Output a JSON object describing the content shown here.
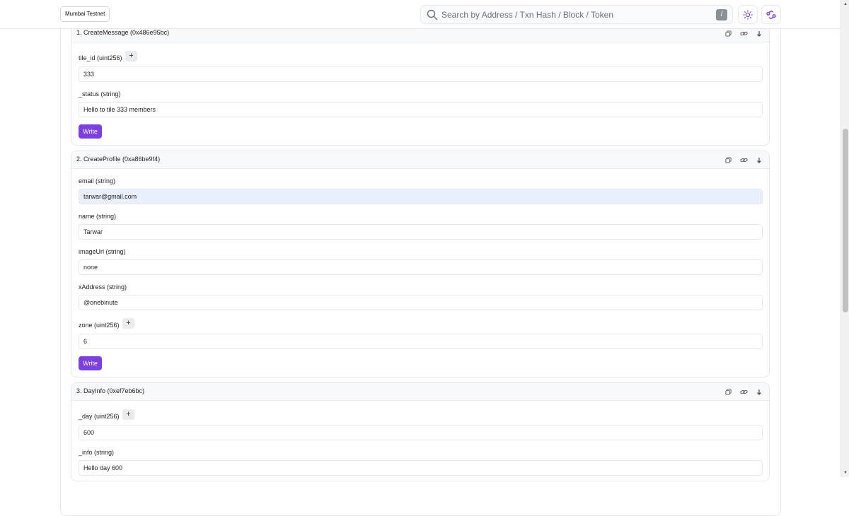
{
  "header": {
    "network_label": "Mumbai Testnet",
    "search_placeholder": "Search by Address / Txn Hash / Block / Token",
    "search_shortcut": "/"
  },
  "colors": {
    "accent": "#7b3fe4",
    "polygon": "#8247e5",
    "highlight_input": "#e8f0fe"
  },
  "sections": [
    {
      "title": "1. CreateMessage (0x486e95bc)",
      "fields": [
        {
          "label": "tile_id (uint256)",
          "value": "333",
          "has_plus": true
        },
        {
          "label": "_status (string)",
          "value": "Hello to tile 333 members",
          "has_plus": false
        }
      ],
      "write_label": "Write"
    },
    {
      "title": "2. CreateProfile (0xa86be9f4)",
      "fields": [
        {
          "label": "email (string)",
          "value": "tarwar@gmail.com",
          "has_plus": false
        },
        {
          "label": "name (string)",
          "value": "Tarwar",
          "has_plus": false
        },
        {
          "label": "imageUrl (string)",
          "value": "none",
          "has_plus": false
        },
        {
          "label": "xAddress (string)",
          "value": "@onebinute",
          "has_plus": false
        },
        {
          "label": "zone (uint256)",
          "value": "6",
          "has_plus": true
        }
      ],
      "write_label": "Write"
    },
    {
      "title": "3. DayInfo (0xef7eb6bc)",
      "fields": [
        {
          "label": "_day (uint256)",
          "value": "600",
          "has_plus": true
        },
        {
          "label": "_info (string)",
          "value": "Hello day 600",
          "has_plus": false
        }
      ]
    }
  ],
  "plus_symbol": "+"
}
